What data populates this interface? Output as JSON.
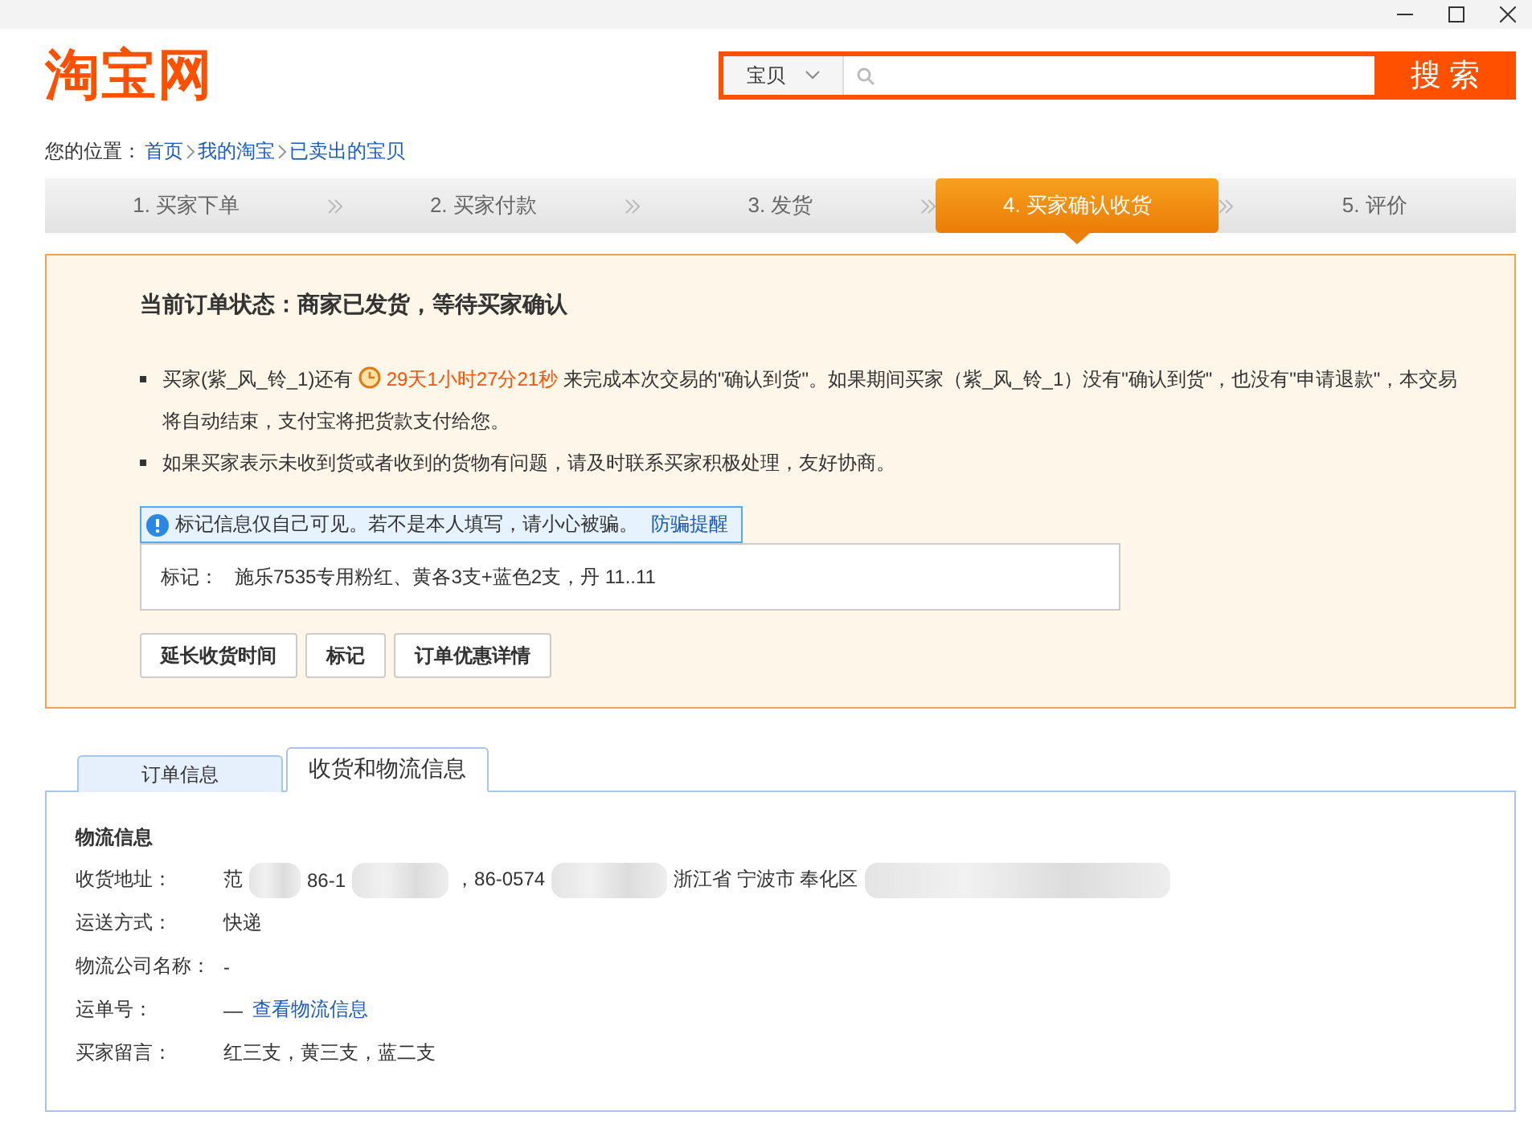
{
  "header": {
    "logo": "淘宝网",
    "search": {
      "category": "宝贝",
      "button": "搜 索"
    }
  },
  "breadcrumb": {
    "label": "您的位置：",
    "links": [
      "首页",
      "我的淘宝",
      "已卖出的宝贝"
    ]
  },
  "steps": [
    {
      "label": "1. 买家下单",
      "selected": false
    },
    {
      "label": "2. 买家付款",
      "selected": false
    },
    {
      "label": "3. 发货",
      "selected": false
    },
    {
      "label": "4. 买家确认收货",
      "selected": true
    },
    {
      "label": "5. 评价",
      "selected": false
    }
  ],
  "status": {
    "title": "当前订单状态：商家已发货，等待买家确认",
    "notes": [
      {
        "kind": "countdown",
        "before": "买家(紫_风_铃_1)还有",
        "countdown": "29天1小时27分21秒",
        "after": "来完成本次交易的\"确认到货\"。如果期间买家（紫_风_铃_1）没有\"确认到货\"，也没有\"申请退款\"，本交易将自动结束，支付宝将把货款支付给您。"
      },
      {
        "kind": "text",
        "text": "如果买家表示未收到货或者收到的货物有问题，请及时联系买家积极处理，友好协商。"
      }
    ]
  },
  "notice": {
    "text": "标记信息仅自己可见。若不是本人填写，请小心被骗。",
    "link": "防骗提醒"
  },
  "remark": {
    "label": "标记：",
    "text": "施乐7535专用粉红、黄各3支+蓝色2支，丹 11..11"
  },
  "buttons": [
    "延长收货时间",
    "标记",
    "订单优惠详情"
  ],
  "tabs": [
    {
      "label": "订单信息",
      "selected": false
    },
    {
      "label": "收货和物流信息",
      "selected": true
    }
  ],
  "logistics": {
    "title": "物流信息",
    "rows": [
      {
        "kind": "address",
        "label": "收货地址：",
        "pieces": [
          {
            "kind": "text",
            "text": "范"
          },
          {
            "kind": "blur"
          },
          {
            "kind": "text",
            "text": "86-1"
          },
          {
            "kind": "blur"
          },
          {
            "kind": "text",
            "text": "，86-0574"
          },
          {
            "kind": "blur"
          },
          {
            "kind": "text",
            "text": "浙江省 宁波市 奉化区"
          },
          {
            "kind": "blur"
          }
        ]
      },
      {
        "kind": "text",
        "label": "运送方式：",
        "value": "快递"
      },
      {
        "kind": "text",
        "label": "物流公司名称：",
        "value": "-"
      },
      {
        "kind": "link",
        "label": "运单号：",
        "value": "—",
        "link": "查看物流信息"
      },
      {
        "kind": "text",
        "label": "买家留言：",
        "value": "红三支，黄三支，蓝二支"
      }
    ]
  }
}
